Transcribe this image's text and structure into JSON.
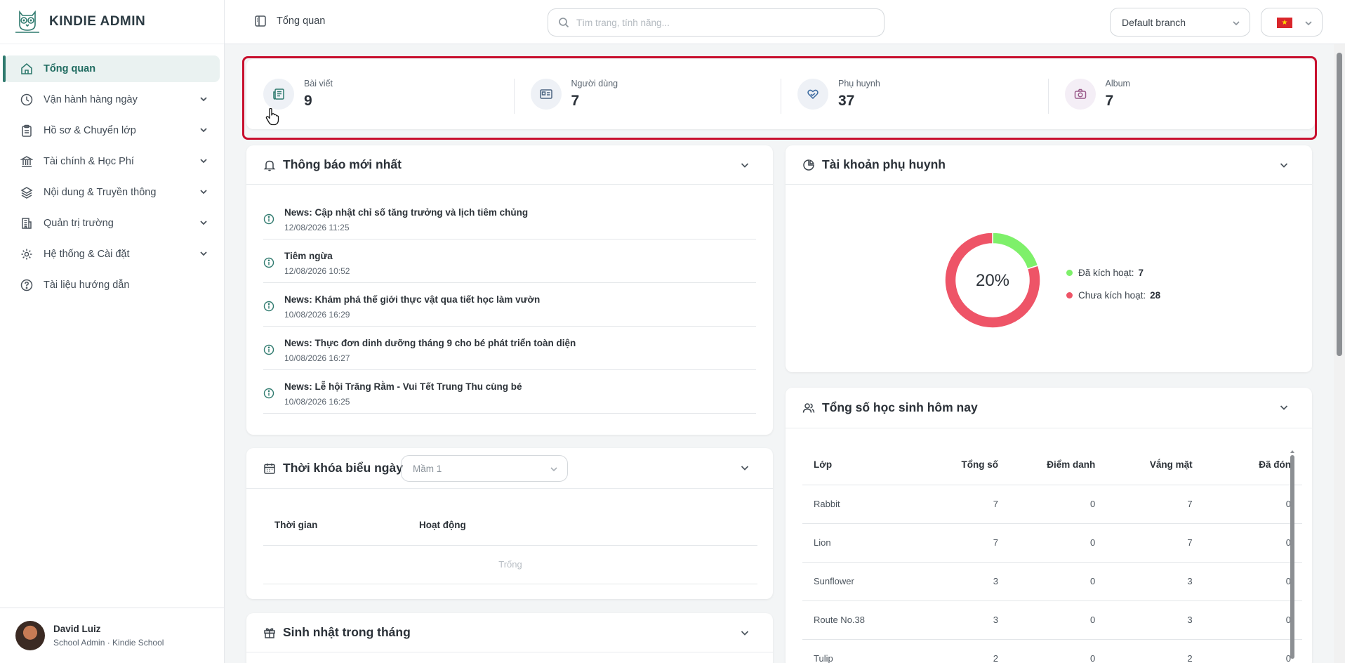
{
  "app": {
    "title": "KINDIE ADMIN"
  },
  "sidebar": {
    "items": [
      {
        "label": "Tổng quan",
        "icon": "home-icon"
      },
      {
        "label": "Vận hành hàng ngày",
        "icon": "clock-icon"
      },
      {
        "label": "Hồ sơ & Chuyển lớp",
        "icon": "clipboard-icon"
      },
      {
        "label": "Tài chính & Học Phí",
        "icon": "bank-icon"
      },
      {
        "label": "Nội dung & Truyền thông",
        "icon": "layers-icon"
      },
      {
        "label": "Quản trị trường",
        "icon": "building-icon"
      },
      {
        "label": "Hệ thống & Cài đặt",
        "icon": "gear-icon"
      },
      {
        "label": "Tài liệu hướng dẫn",
        "icon": "help-icon"
      }
    ]
  },
  "user": {
    "name": "David Luiz",
    "role": "School Admin · Kindie School"
  },
  "header": {
    "breadcrumb": "Tổng quan",
    "search_placeholder": "Tìm trang, tính năng...",
    "branch": "Default branch",
    "language_flag": "vietnam-flag"
  },
  "stats": [
    {
      "label": "Bài viết",
      "value": "9",
      "icon": "newspaper-icon"
    },
    {
      "label": "Người dùng",
      "value": "7",
      "icon": "id-card-icon"
    },
    {
      "label": "Phụ huynh",
      "value": "37",
      "icon": "heart-hand-icon"
    },
    {
      "label": "Album",
      "value": "7",
      "icon": "camera-icon"
    }
  ],
  "notifications": {
    "title": "Thông báo mới nhất",
    "items": [
      {
        "title": "News: Cập nhật chỉ số tăng trưởng và lịch tiêm chủng",
        "date": "12/08/2026 11:25"
      },
      {
        "title": "Tiêm ngừa",
        "date": "12/08/2026 10:52"
      },
      {
        "title": "News: Khám phá thế giới thực vật qua tiết học làm vườn",
        "date": "10/08/2026 16:29"
      },
      {
        "title": "News: Thực đơn dinh dưỡng tháng 9 cho bé phát triển toàn diện",
        "date": "10/08/2026 16:27"
      },
      {
        "title": "News: Lễ hội Trăng Rằm - Vui Tết Trung Thu cùng bé",
        "date": "10/08/2026 16:25"
      }
    ]
  },
  "parent_accounts": {
    "title": "Tài khoản phụ huynh",
    "center_label": "20%",
    "legend": [
      {
        "label": "Đã kích hoạt:",
        "value": "7",
        "color": "#7ef06a"
      },
      {
        "label": "Chưa kích hoạt:",
        "value": "28",
        "color": "#ee5467"
      }
    ]
  },
  "chart_data": {
    "type": "pie",
    "categories": [
      "Đã kích hoạt",
      "Chưa kích hoạt"
    ],
    "values": [
      7,
      28
    ],
    "colors": [
      "#7ef06a",
      "#ee5467"
    ],
    "center_label": "20%",
    "legend_position": "right"
  },
  "schedule": {
    "title": "Thời khóa biểu ngày",
    "class_select": "Mầm 1",
    "columns": [
      "Thời gian",
      "Hoạt động"
    ],
    "empty": "Trống"
  },
  "students": {
    "title": "Tổng số học sinh hôm nay",
    "columns": [
      "Lớp",
      "Tổng số",
      "Điểm danh",
      "Vắng mặt",
      "Đã đón"
    ],
    "rows": [
      [
        "Rabbit",
        "7",
        "0",
        "7",
        "0"
      ],
      [
        "Lion",
        "7",
        "0",
        "7",
        "0"
      ],
      [
        "Sunflower",
        "3",
        "0",
        "3",
        "0"
      ],
      [
        "Route No.38",
        "3",
        "0",
        "3",
        "0"
      ],
      [
        "Tulip",
        "2",
        "0",
        "2",
        "0"
      ]
    ]
  },
  "birthdays": {
    "title": "Sinh nhật trong tháng"
  },
  "colors": {
    "accent": "#2f7a6e",
    "highlight": "#c8102e"
  }
}
